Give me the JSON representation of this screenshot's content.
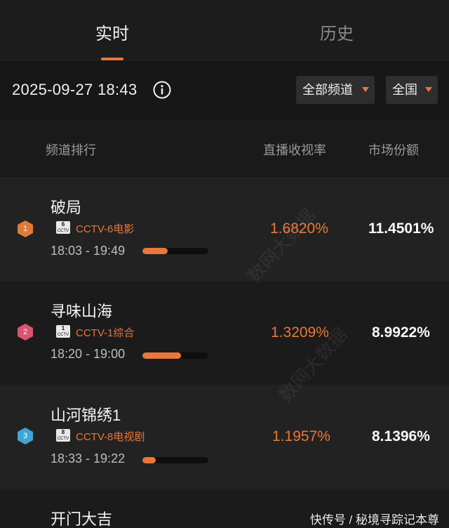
{
  "tabs": {
    "realtime": "实时",
    "history": "历史"
  },
  "filter": {
    "datetime": "2025-09-27 18:43",
    "channel_filter": "全部频道",
    "region_filter": "全国"
  },
  "columns": {
    "rank": "频道排行",
    "rating": "直播收视率",
    "share": "市场份额"
  },
  "rows": [
    {
      "rank": "1",
      "title": "破局",
      "channel": "CCTV-6电影",
      "logo_top": "6",
      "logo_bottom": "CCTV",
      "time": "18:03 - 19:49",
      "rating": "1.6820%",
      "share": "11.4501%",
      "progress": 0.38,
      "badge_color": "#e07a3a"
    },
    {
      "rank": "2",
      "title": "寻味山海",
      "channel": "CCTV-1综合",
      "logo_top": "1",
      "logo_bottom": "CCTV",
      "time": "18:20 - 19:00",
      "rating": "1.3209%",
      "share": "8.9922%",
      "progress": 0.58,
      "badge_color": "#d9546e"
    },
    {
      "rank": "3",
      "title": "山河锦绣1",
      "channel": "CCTV-8电视剧",
      "logo_top": "8",
      "logo_bottom": "CCTV",
      "time": "18:33 - 19:22",
      "rating": "1.1957%",
      "share": "8.1396%",
      "progress": 0.2,
      "badge_color": "#3fa6d6"
    }
  ],
  "next_row": {
    "title": "开门大吉"
  },
  "watermark": {
    "footer": "快传号 / 秘境寻踪记本尊",
    "overlay": "数网大数据"
  }
}
